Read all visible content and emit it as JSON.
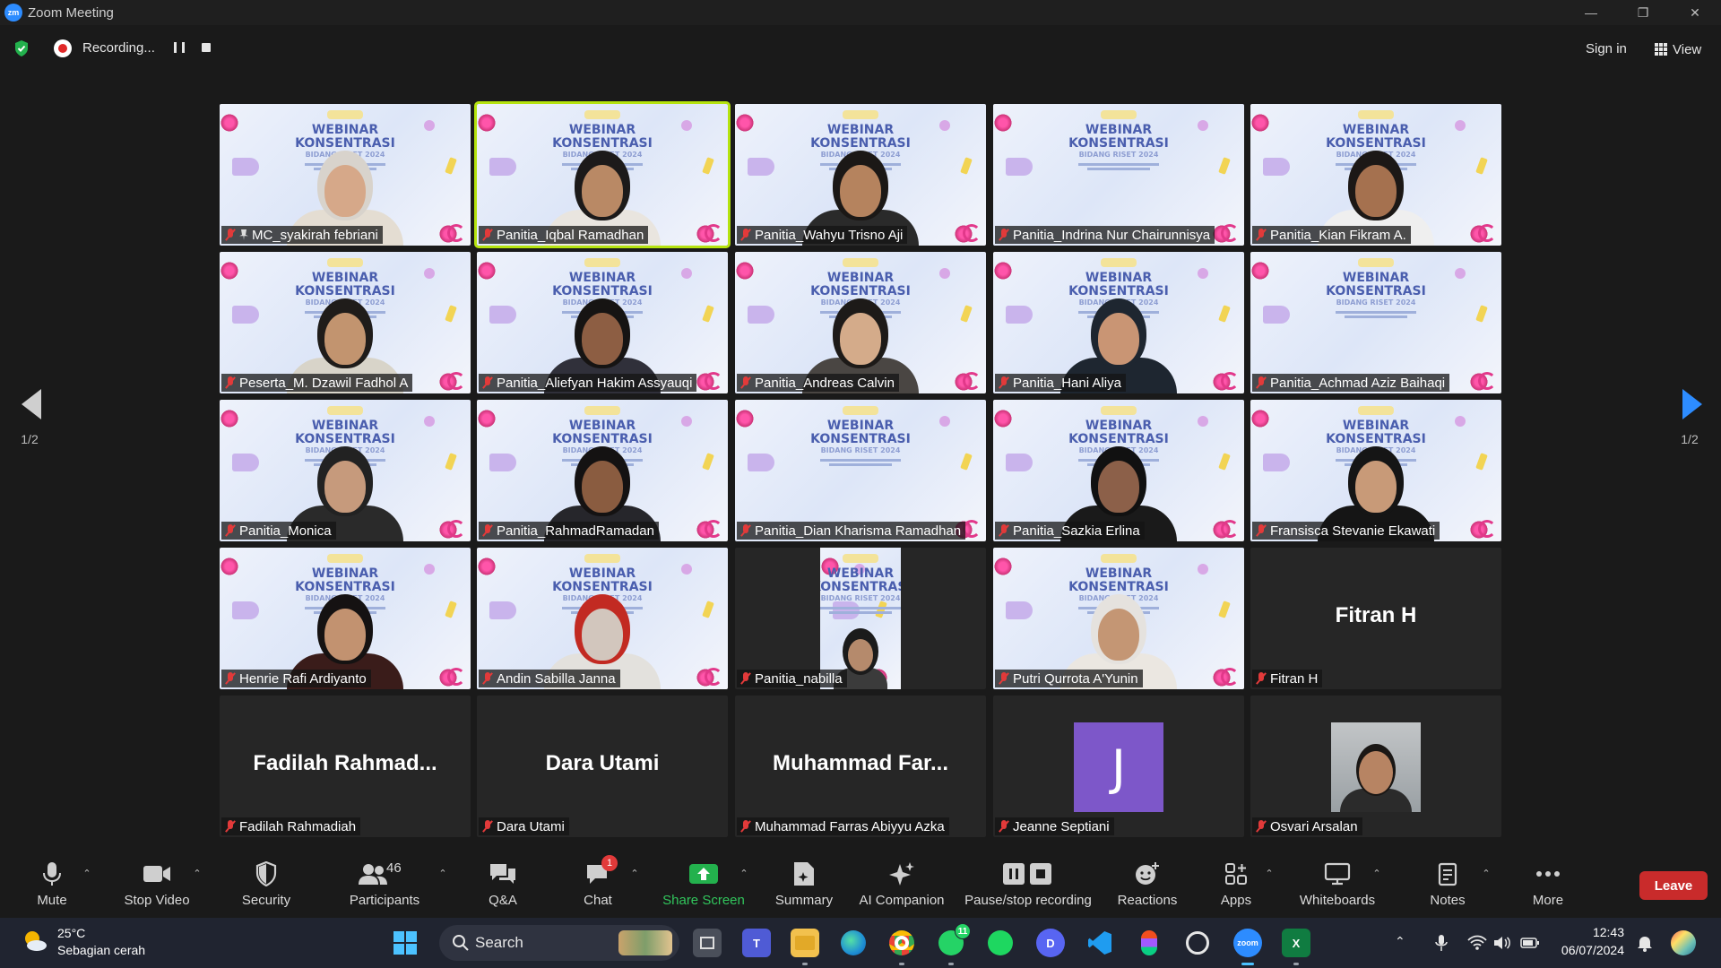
{
  "window": {
    "title": "Zoom Meeting",
    "app_badge": "zm"
  },
  "topbar": {
    "recording_label": "Recording...",
    "sign_in": "Sign in",
    "view": "View"
  },
  "gallery": {
    "page_indicator_left": "1/2",
    "page_indicator_right": "1/2",
    "tiles": [
      {
        "name": "MC_syakirah febriani",
        "type": "video",
        "pinned": true,
        "skin": "#d6a889",
        "hair": "#d8d3cc",
        "shirt": "#e4ddd2"
      },
      {
        "name": "Panitia_Iqbal Ramadhan",
        "type": "video",
        "active": true,
        "skin": "#b98965",
        "hair": "#1c1a1a",
        "shirt": "#e9e5df"
      },
      {
        "name": "Panitia_Wahyu Trisno Aji",
        "type": "video",
        "skin": "#b5835e",
        "hair": "#1b1816",
        "shirt": "#2a2a2a"
      },
      {
        "name": "Panitia_Indrina Nur Chairunnisya",
        "type": "video_background_only"
      },
      {
        "name": "Panitia_Kian Fikram A.",
        "type": "video",
        "skin": "#a5714f",
        "hair": "#1c1816",
        "shirt": "#efefef"
      },
      {
        "name": "Peserta_M. Dzawil Fadhol A",
        "type": "video",
        "skin": "#c2946f",
        "hair": "#1f1c1a",
        "shirt": "#d8d4c9"
      },
      {
        "name": "Panitia_Aliefyan Hakim Assyauqi",
        "type": "video",
        "skin": "#8d5e43",
        "hair": "#161413",
        "shirt": "#30303a"
      },
      {
        "name": "Panitia_Andreas Calvin",
        "type": "video",
        "skin": "#d4ab8a",
        "hair": "#1d1a18",
        "shirt": "#4a4643"
      },
      {
        "name": "Panitia_Hani Aliya",
        "type": "video",
        "skin": "#c99574",
        "hair": "#1e2630",
        "shirt": "#1e2630"
      },
      {
        "name": "Panitia_Achmad Aziz Baihaqi",
        "type": "video_background_only"
      },
      {
        "name": "Panitia_Monica",
        "type": "video",
        "skin": "#c69a7c",
        "hair": "#222",
        "shirt": "#2a2a2a"
      },
      {
        "name": "Panitia_RahmadRamadan",
        "type": "video",
        "skin": "#8a5c40",
        "hair": "#141212",
        "shirt": "#26262b"
      },
      {
        "name": "Panitia_Dian Kharisma Ramadhan",
        "type": "video_background_only"
      },
      {
        "name": "Panitia_Sazkia Erlina",
        "type": "video",
        "skin": "#8c6049",
        "hair": "#111",
        "shirt": "#1a1a1a"
      },
      {
        "name": "Fransisca Stevanie Ekawati",
        "type": "video",
        "skin": "#c89a78",
        "hair": "#151515",
        "shirt": "#151515"
      },
      {
        "name": "Henrie Rafi Ardiyanto",
        "type": "video",
        "skin": "#c29270",
        "hair": "#151212",
        "shirt": "#3a1c1a"
      },
      {
        "name": "Andin Sabilla Janna",
        "type": "video",
        "skin": "#d2c6bd",
        "hair": "#c22a22",
        "shirt": "#e3e1dd"
      },
      {
        "name": "Panitia_nabilla",
        "type": "narrow_video",
        "skin": "#b58a6c",
        "hair": "#1b1b1b",
        "shirt": "#3b3b3b"
      },
      {
        "name": "Putri Qurrota A'Yunin",
        "type": "video",
        "skin": "#c49674",
        "hair": "#e5e2de",
        "shirt": "#ebe7e1"
      },
      {
        "name": "Fitran H",
        "type": "name_only",
        "display": "Fitran H"
      },
      {
        "name": "Fadilah Rahmadiah",
        "type": "name_only",
        "display": "Fadilah  Rahmad..."
      },
      {
        "name": "Dara Utami",
        "type": "name_only",
        "display": "Dara Utami"
      },
      {
        "name": "Muhammad Farras Abiyyu Azka",
        "type": "name_only",
        "display": "Muhammad  Far..."
      },
      {
        "name": "Jeanne Septiani",
        "type": "initial_avatar",
        "initial": "J",
        "color": "#7d57c9"
      },
      {
        "name": "Osvari Arsalan",
        "type": "photo_avatar",
        "skin": "#b78463",
        "hair": "#1a1715",
        "shirt": "#2b2b2b"
      }
    ],
    "slide": {
      "line1": "WEBINAR",
      "line2": "KONSENTRASI",
      "line3": "BIDANG RISET 2024"
    }
  },
  "toolbar": {
    "mute": "Mute",
    "stop_video": "Stop Video",
    "security": "Security",
    "participants": "Participants",
    "participants_count": "46",
    "qa": "Q&A",
    "chat": "Chat",
    "chat_badge": "1",
    "share_screen": "Share Screen",
    "summary": "Summary",
    "ai_companion": "AI Companion",
    "pause_stop_recording": "Pause/stop recording",
    "reactions": "Reactions",
    "apps": "Apps",
    "whiteboards": "Whiteboards",
    "notes": "Notes",
    "more": "More",
    "leave": "Leave"
  },
  "taskbar": {
    "temperature": "25°C",
    "weather": "Sebagian cerah",
    "search": "Search",
    "whatsapp_badge": "11",
    "time": "12:43",
    "date": "06/07/2024"
  }
}
